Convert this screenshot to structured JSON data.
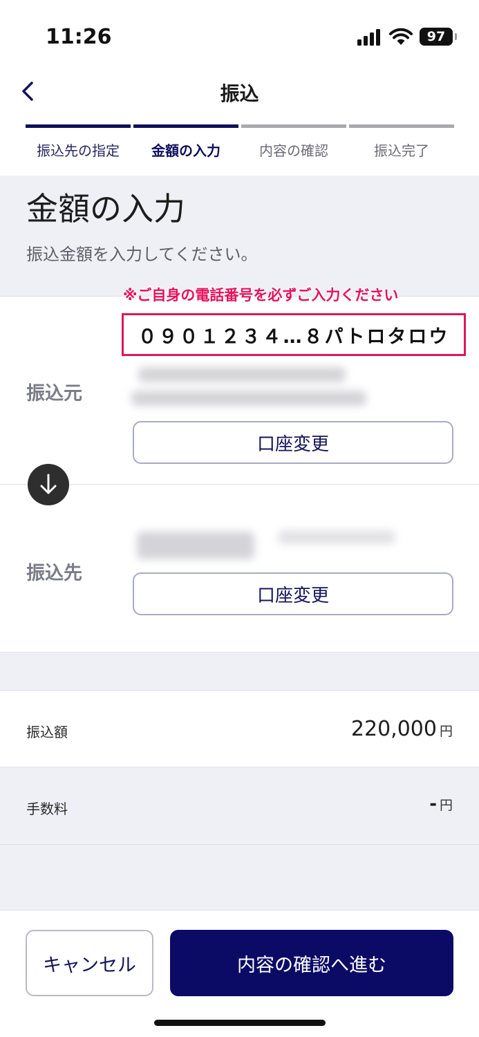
{
  "status_bar": {
    "time": "11:26",
    "battery": "97"
  },
  "header": {
    "title": "振込"
  },
  "steps": [
    {
      "label": "振込先の指定"
    },
    {
      "label": "金額の入力"
    },
    {
      "label": "内容の確認"
    },
    {
      "label": "振込完了"
    }
  ],
  "page": {
    "title": "金額の入力",
    "description": "振込金額を入力してください。"
  },
  "accounts": {
    "notice": "※ご自身の電話番号を必ずご入力ください",
    "highlight_text": "０９０１２３４…８パトロタロウ",
    "from_label": "振込元",
    "to_label": "振込先",
    "change_from_label": "口座変更",
    "change_to_label": "口座変更"
  },
  "amount": {
    "label": "振込額",
    "value": "220,000",
    "unit": "円"
  },
  "fee": {
    "label": "手数料",
    "value": "-",
    "unit": "円"
  },
  "footer": {
    "cancel_label": "キャンセル",
    "confirm_label": "内容の確認へ進む"
  },
  "colors": {
    "primary": "#0b0b66",
    "highlight": "#e0165a",
    "step_inactive": "#a8a8ad",
    "background_gray": "#eff0f5"
  }
}
